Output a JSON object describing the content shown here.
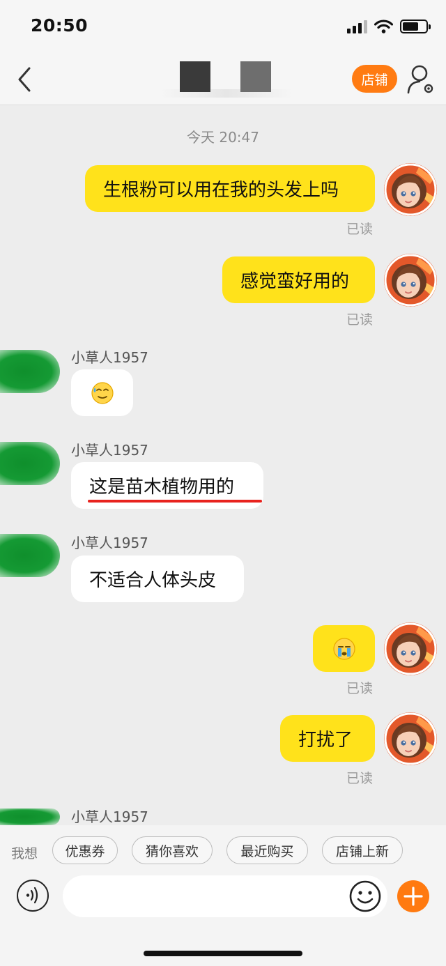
{
  "status_bar": {
    "time": "20:50",
    "battery_level": 0.7
  },
  "header": {
    "shop_label": "店铺"
  },
  "chat": {
    "date_label": "今天 20:47",
    "read_label": "已读",
    "sender_name": "小草人1957",
    "messages": [
      {
        "from": "me",
        "text": "生根粉可以用在我的头发上吗",
        "read": true
      },
      {
        "from": "me",
        "text": "感觉蛮好用的",
        "read": true
      },
      {
        "from": "them",
        "type": "emoji",
        "emoji": "sweat-smile-emoji"
      },
      {
        "from": "them",
        "text": "这是苗木植物用的",
        "underlined": true
      },
      {
        "from": "them",
        "text": "不适合人体头皮"
      },
      {
        "from": "me",
        "type": "emoji",
        "emoji": "crying-emoji",
        "read": true
      },
      {
        "from": "me",
        "text": "打扰了",
        "read": true
      }
    ]
  },
  "quick_replies": {
    "label": "我想",
    "chips": [
      "优惠券",
      "猜你喜欢",
      "最近购买",
      "店铺上新"
    ]
  },
  "colors": {
    "my_bubble": "#ffe21b",
    "their_bubble": "#ffffff",
    "accent_orange": "#ff7b12",
    "underline_red": "#e8231e"
  }
}
